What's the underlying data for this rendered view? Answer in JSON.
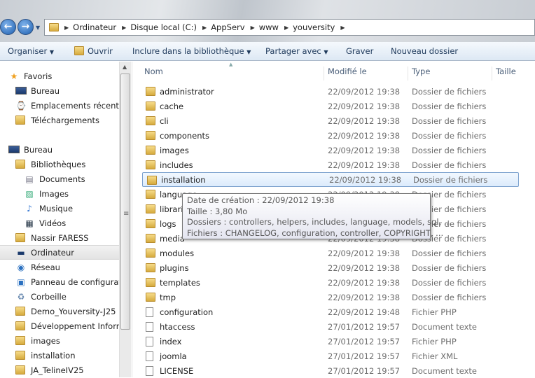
{
  "breadcrumb": [
    "Ordinateur",
    "Disque local (C:)",
    "AppServ",
    "www",
    "youversity"
  ],
  "toolbar": {
    "organize": "Organiser",
    "open": "Ouvrir",
    "include": "Inclure dans la bibliothèque",
    "share": "Partager avec",
    "burn": "Graver",
    "new_folder": "Nouveau dossier"
  },
  "sidebar": {
    "items": [
      {
        "label": "Favoris",
        "icon": "star-icon"
      },
      {
        "label": "Bureau",
        "icon": "desktop-icon"
      },
      {
        "label": "Emplacements récents",
        "icon": "recent-places-icon"
      },
      {
        "label": "Téléchargements",
        "icon": "downloads-icon"
      },
      {
        "label": "Bureau",
        "icon": "desktop-icon"
      },
      {
        "label": "Bibliothèques",
        "icon": "libraries-icon"
      },
      {
        "label": "Documents",
        "icon": "documents-icon"
      },
      {
        "label": "Images",
        "icon": "pictures-icon"
      },
      {
        "label": "Musique",
        "icon": "music-icon"
      },
      {
        "label": "Vidéos",
        "icon": "videos-icon"
      },
      {
        "label": "Nassir FARESS",
        "icon": "user-folder-icon"
      },
      {
        "label": "Ordinateur",
        "icon": "computer-icon"
      },
      {
        "label": "Réseau",
        "icon": "network-icon"
      },
      {
        "label": "Panneau de configuration",
        "icon": "control-panel-icon"
      },
      {
        "label": "Corbeille",
        "icon": "recycle-bin-icon"
      },
      {
        "label": "Demo_Youversity-J25",
        "icon": "folder-icon"
      },
      {
        "label": "Développement Informatique",
        "icon": "folder-icon"
      },
      {
        "label": "images",
        "icon": "folder-icon"
      },
      {
        "label": "installation",
        "icon": "folder-icon"
      },
      {
        "label": "JA_TelineIV25",
        "icon": "folder-icon"
      }
    ],
    "selected": "Ordinateur"
  },
  "columns": {
    "name": "Nom",
    "modified": "Modifié le",
    "type": "Type",
    "size": "Taille"
  },
  "files": [
    {
      "name": "administrator",
      "modified": "22/09/2012 19:38",
      "type": "Dossier de fichiers",
      "kind": "folder"
    },
    {
      "name": "cache",
      "modified": "22/09/2012 19:38",
      "type": "Dossier de fichiers",
      "kind": "folder"
    },
    {
      "name": "cli",
      "modified": "22/09/2012 19:38",
      "type": "Dossier de fichiers",
      "kind": "folder"
    },
    {
      "name": "components",
      "modified": "22/09/2012 19:38",
      "type": "Dossier de fichiers",
      "kind": "folder"
    },
    {
      "name": "images",
      "modified": "22/09/2012 19:38",
      "type": "Dossier de fichiers",
      "kind": "folder"
    },
    {
      "name": "includes",
      "modified": "22/09/2012 19:38",
      "type": "Dossier de fichiers",
      "kind": "folder"
    },
    {
      "name": "installation",
      "modified": "22/09/2012 19:38",
      "type": "Dossier de fichiers",
      "kind": "folder"
    },
    {
      "name": "language",
      "modified": "22/09/2012 19:38",
      "type": "Dossier de fichiers",
      "kind": "folder"
    },
    {
      "name": "libraries",
      "modified": "22/09/2012 19:38",
      "type": "Dossier de fichiers",
      "kind": "folder"
    },
    {
      "name": "logs",
      "modified": "22/09/2012 19:38",
      "type": "Dossier de fichiers",
      "kind": "folder"
    },
    {
      "name": "media",
      "modified": "22/09/2012 19:38",
      "type": "Dossier de fichiers",
      "kind": "folder"
    },
    {
      "name": "modules",
      "modified": "22/09/2012 19:38",
      "type": "Dossier de fichiers",
      "kind": "folder"
    },
    {
      "name": "plugins",
      "modified": "22/09/2012 19:38",
      "type": "Dossier de fichiers",
      "kind": "folder"
    },
    {
      "name": "templates",
      "modified": "22/09/2012 19:38",
      "type": "Dossier de fichiers",
      "kind": "folder"
    },
    {
      "name": "tmp",
      "modified": "22/09/2012 19:38",
      "type": "Dossier de fichiers",
      "kind": "folder"
    },
    {
      "name": "configuration",
      "modified": "22/09/2012 19:48",
      "type": "Fichier PHP",
      "kind": "file"
    },
    {
      "name": "htaccess",
      "modified": "27/01/2012 19:57",
      "type": "Document texte",
      "kind": "file"
    },
    {
      "name": "index",
      "modified": "27/01/2012 19:57",
      "type": "Fichier PHP",
      "kind": "file"
    },
    {
      "name": "joomla",
      "modified": "27/01/2012 19:57",
      "type": "Fichier XML",
      "kind": "file"
    },
    {
      "name": "LICENSE",
      "modified": "27/01/2012 19:57",
      "type": "Document texte",
      "kind": "file"
    }
  ],
  "hovered": "installation",
  "tooltip": {
    "created": "Date de création : 22/09/2012 19:38",
    "size": "Taille : 3,80 Mo",
    "folders": "Dossiers : controllers, helpers, includes, language, models, sql, ...",
    "files": "Fichiers : CHANGELOG, configuration, controller, COPYRIGHT, ..."
  }
}
